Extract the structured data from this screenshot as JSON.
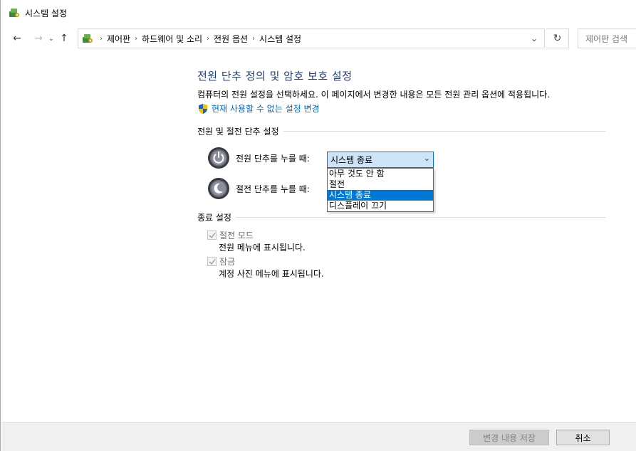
{
  "window": {
    "title": "시스템 설정"
  },
  "nav": {
    "back_icon": "←",
    "forward_icon": "→",
    "recent_icon": "⌄",
    "up_icon": "↑",
    "breadcrumbs": [
      "제어판",
      "하드웨어 및 소리",
      "전원 옵션",
      "시스템 설정"
    ],
    "crumb_sep": "›",
    "dropdown_icon": "⌄",
    "refresh_icon": "↻",
    "search_placeholder": "제어판 검색"
  },
  "content": {
    "title": "전원 단추 정의 및 암호 보호 설정",
    "description": "컴퓨터의 전원 설정을 선택하세요. 이 페이지에서 변경한 내용은 모든 전원 관리 옵션에 적용됩니다.",
    "change_link": "현재 사용할 수 없는 설정 변경",
    "power_section": "전원 및 절전 단추 설정",
    "power_button_label": "전원 단추를 누를 때:",
    "sleep_button_label": "절전 단추를 누를 때:",
    "power_button_value": "시스템 종료",
    "dropdown_options": [
      "아무 것도 안 함",
      "절전",
      "시스템 종료",
      "디스플레이 끄기"
    ],
    "dropdown_selected_index": 2,
    "shutdown_section": "종료 설정",
    "sleep_mode_label": "절전 모드",
    "sleep_mode_desc": "전원 메뉴에 표시됩니다.",
    "lock_label": "잠금",
    "lock_desc": "계정 사진 메뉴에 표시됩니다."
  },
  "footer": {
    "save_label": "변경 내용 저장",
    "cancel_label": "취소"
  },
  "colors": {
    "title_blue": "#1e3c78",
    "link_blue": "#0066cc",
    "accent": "#0078d7"
  }
}
